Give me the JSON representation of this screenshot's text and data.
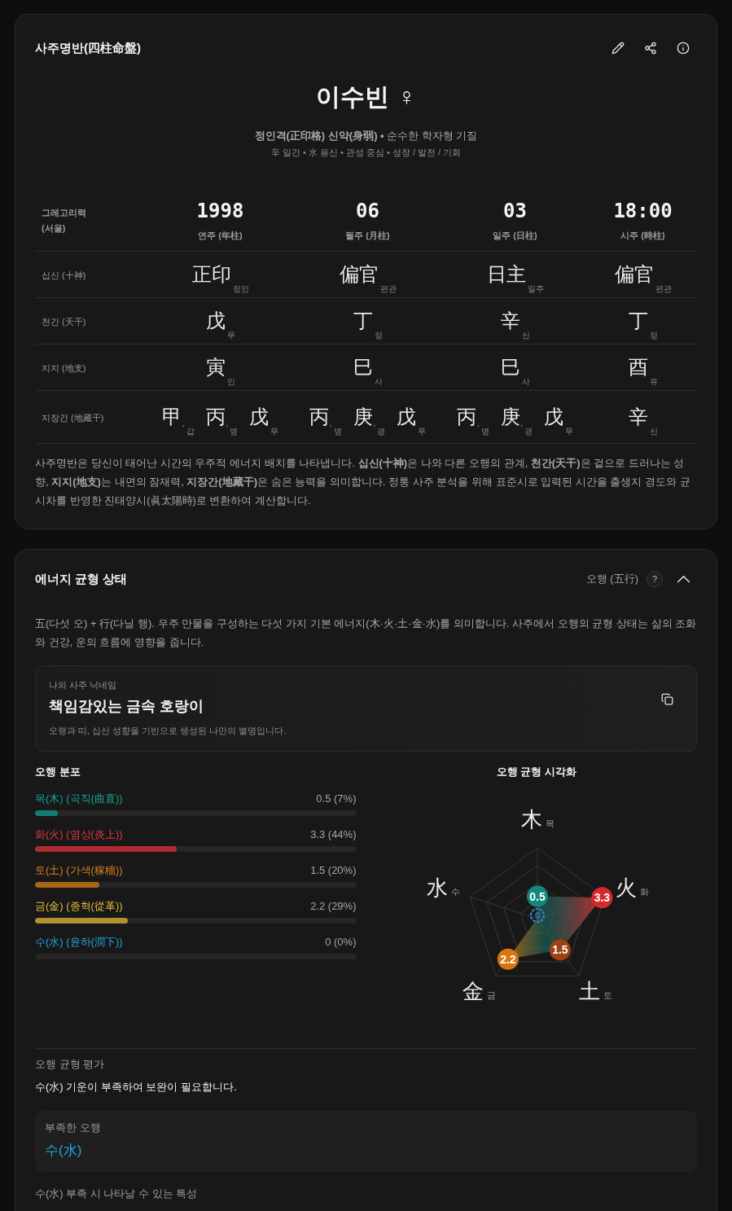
{
  "chart_card": {
    "title": "사주명반(四柱命盤)",
    "person": {
      "name": "이수빈",
      "gender_symbol": "♀"
    },
    "summary": "**정인격(正印格) 신약(身弱) •** 순수한 학자형 기질",
    "tags": "辛 일간 • 水 용신 • 관성 중심 • 성장 / 발전 / 기회",
    "table": {
      "calendar": "그레고리력",
      "location": "(서울)",
      "pillars": [
        {
          "value": "1998",
          "label": "연주 (年柱)"
        },
        {
          "value": "06",
          "label": "월주 (月柱)"
        },
        {
          "value": "03",
          "label": "일주 (日柱)"
        },
        {
          "value": "18:00",
          "label": "시주 (時柱)"
        }
      ],
      "rows": [
        {
          "label": "십신 (十神)",
          "cells": [
            {
              "items": [
                {
                  "hanja": "正印",
                  "reading": "정인"
                }
              ]
            },
            {
              "items": [
                {
                  "hanja": "偏官",
                  "reading": "편관"
                }
              ]
            },
            {
              "items": [
                {
                  "hanja": "日主",
                  "reading": "일주"
                }
              ]
            },
            {
              "items": [
                {
                  "hanja": "偏官",
                  "reading": "편관"
                }
              ]
            }
          ]
        },
        {
          "label": "천간 (天干)",
          "cells": [
            {
              "items": [
                {
                  "hanja": "戊",
                  "reading": "무"
                }
              ]
            },
            {
              "items": [
                {
                  "hanja": "丁",
                  "reading": "정"
                }
              ]
            },
            {
              "items": [
                {
                  "hanja": "辛",
                  "reading": "신"
                }
              ]
            },
            {
              "items": [
                {
                  "hanja": "丁",
                  "reading": "정"
                }
              ]
            }
          ]
        },
        {
          "label": "지지 (地支)",
          "cells": [
            {
              "items": [
                {
                  "hanja": "寅",
                  "reading": "인"
                }
              ]
            },
            {
              "items": [
                {
                  "hanja": "巳",
                  "reading": "사"
                }
              ]
            },
            {
              "items": [
                {
                  "hanja": "巳",
                  "reading": "사"
                }
              ]
            },
            {
              "items": [
                {
                  "hanja": "酉",
                  "reading": "유"
                }
              ]
            }
          ]
        },
        {
          "label": "지장간 (地藏干)",
          "cells": [
            {
              "items": [
                {
                  "hanja": "甲",
                  "reading": "갑",
                  "separator": ","
                },
                {
                  "hanja": "丙",
                  "reading": "병",
                  "separator": ","
                },
                {
                  "hanja": "戊",
                  "reading": "무"
                }
              ]
            },
            {
              "items": [
                {
                  "hanja": "丙",
                  "reading": "병",
                  "separator": ","
                },
                {
                  "hanja": "庚",
                  "reading": "경",
                  "separator": ","
                },
                {
                  "hanja": "戊",
                  "reading": "무"
                }
              ]
            },
            {
              "items": [
                {
                  "hanja": "丙",
                  "reading": "병",
                  "separator": ","
                },
                {
                  "hanja": "庚",
                  "reading": "경",
                  "separator": ","
                },
                {
                  "hanja": "戊",
                  "reading": "무"
                }
              ]
            },
            {
              "items": [
                {
                  "hanja": "辛",
                  "reading": "신"
                }
              ]
            }
          ]
        }
      ]
    },
    "description": "사주명반은 당신이 태어난 시간의 우주적 에너지 배치를 나타냅니다. **십신(十神)**은 나와 다른 오행의 관계, **천간(天干)**은 겉으로 드러나는 성향, **지지(地支)**는 내면의 잠재력, **지장간(地藏干)**은 숨은 능력을 의미합니다. 정통 사주 분석을 위해 표준시로 입력된 시간을 출생지 경도와 균시차를 반영한 진태양시(眞太陽時)로 변환하여 계산합니다."
  },
  "energy_card": {
    "title": "에너지 균형 상태",
    "topic": "오행 (五行)",
    "help": "?",
    "expanded": true,
    "description": "五(다섯 오) + 行(다닐 행). 우주 만물을 구성하는 다섯 가지 기본 에너지(木·火·土·金·水)를 의미합니다. 사주에서 오행의 균형 상태는 삶의 조화와 건강, 운의 흐름에 영향을 줍니다.",
    "nickname": {
      "label": "나의 사주 닉네임",
      "name": "책임감있는 금속 호랑이",
      "note": "오행과 띠, 십신 성향을 기반으로 생성된 나만의 별명입니다."
    },
    "distribution": {
      "title": "오행 분포",
      "items": [
        {
          "label": "목(木) (곡직(曲直))",
          "value": "0.5 (7%)",
          "level": 0.07,
          "color": "#14a394"
        },
        {
          "label": "화(火) (염상(炎上))",
          "value": "3.3 (44%)",
          "level": 0.44,
          "color": "#e0393e"
        },
        {
          "label": "토(土) (가색(稼穡))",
          "value": "1.5 (20%)",
          "level": 0.2,
          "color": "#d9821c"
        },
        {
          "label": "금(金) (종혁(從革))",
          "value": "2.2 (29%)",
          "level": 0.29,
          "color": "#e2bb3c"
        },
        {
          "label": "수(水) (윤하(潤下))",
          "value": "0 (0%)",
          "color": "#23a6e3"
        }
      ]
    },
    "radar": {
      "title": "오행 균형 시각화",
      "axes": [
        {
          "hanja": "木",
          "reading": "목",
          "value": "0.5",
          "color": "#13897d"
        },
        {
          "hanja": "水",
          "reading": "수",
          "value": "0",
          "color": "#2f80d0"
        },
        {
          "hanja": "火",
          "reading": "화",
          "value": "3.3",
          "color": "#d42a2f"
        },
        {
          "hanja": "金",
          "reading": "금",
          "value": "2.2",
          "color": "#d9770f"
        },
        {
          "hanja": "土",
          "reading": "토",
          "value": "1.5",
          "color": "#9e4214"
        }
      ]
    },
    "assessment": {
      "label": "오행 균형 평가",
      "text": "수(水) 기운이 부족하여 보완이 필요합니다.",
      "lacking": {
        "label": "부족한 오행",
        "value": "수(水)"
      },
      "traits_heading": "수(水) 부족 시 나타날 수 있는 특성"
    }
  }
}
